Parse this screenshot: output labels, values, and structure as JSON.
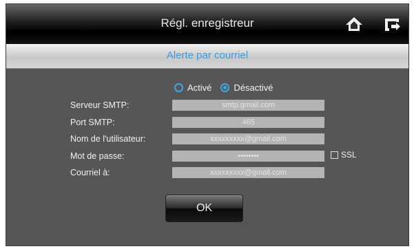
{
  "header": {
    "title": "Régl. enregistreur",
    "home_icon": "home-icon",
    "back_icon": "return-icon"
  },
  "subheader": {
    "title": "Alerte par courriel"
  },
  "status": {
    "options": [
      {
        "label": "Activé",
        "selected": false
      },
      {
        "label": "Désactivé",
        "selected": true
      }
    ]
  },
  "fields": {
    "smtp_server": {
      "label": "Serveur SMTP:",
      "value": "smtp.gmail.com"
    },
    "smtp_port": {
      "label": "Port SMTP:",
      "value": "465"
    },
    "username": {
      "label": "Nom de l'utilisateur:",
      "value": "xxxxxxxxx@gmail.com"
    },
    "password": {
      "label": "Mot de passe:",
      "value": "••••••••"
    },
    "recipient": {
      "label": "Courriel à:",
      "value": "xxxxxxxxx@gmail.com"
    }
  },
  "ssl": {
    "label": "SSL",
    "checked": false
  },
  "actions": {
    "ok_label": "OK"
  },
  "colors": {
    "accent": "#3aa7e6",
    "panel": "#565656",
    "input": "#b4b4b4"
  }
}
